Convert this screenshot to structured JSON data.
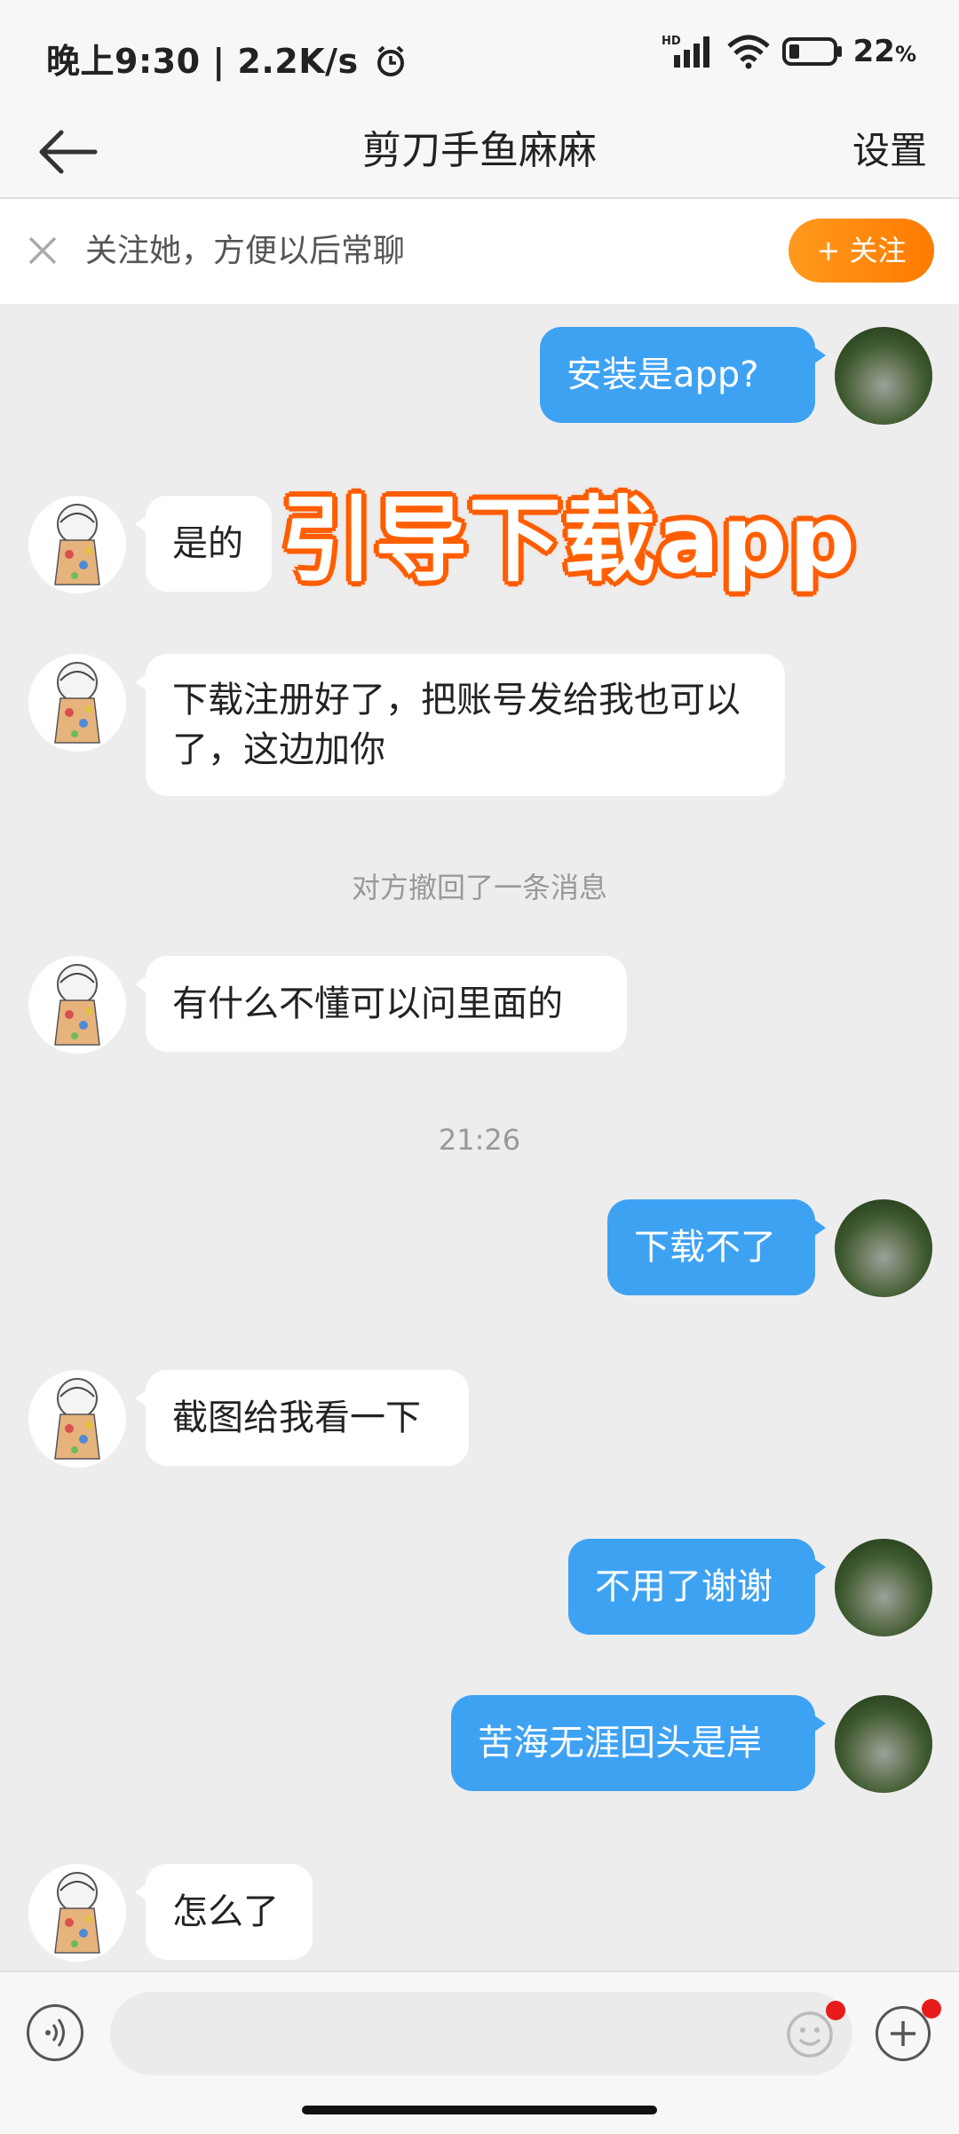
{
  "status_bar": {
    "time": "晚上9:30",
    "speed": "2.2K/s",
    "network": "HD",
    "battery": "22",
    "battery_unit": "%"
  },
  "nav": {
    "title": "剪刀手鱼麻麻",
    "settings_label": "设置"
  },
  "follow_bar": {
    "text": "关注她，方便以后常聊",
    "button_label": "+ 关注"
  },
  "messages": [
    {
      "sender": "me",
      "text": "安装是app?"
    },
    {
      "sender": "other",
      "text": "是的"
    },
    {
      "sender": "other",
      "text": "下载注册好了，把账号发给我也可以了，这边加你"
    },
    {
      "sender": "system",
      "text": "对方撤回了一条消息"
    },
    {
      "sender": "other",
      "text": "有什么不懂可以问里面的"
    },
    {
      "sender": "time",
      "text": "21:26"
    },
    {
      "sender": "me",
      "text": "下载不了"
    },
    {
      "sender": "other",
      "text": "截图给我看一下"
    },
    {
      "sender": "me",
      "text": "不用了谢谢"
    },
    {
      "sender": "me",
      "text": "苦海无涯回头是岸"
    },
    {
      "sender": "other",
      "text": "怎么了"
    }
  ],
  "overlay_caption": "引导下载app",
  "input_bar": {
    "placeholder": ""
  },
  "colors": {
    "my_bubble": "#3ea2f3",
    "other_bubble": "#ffffff",
    "follow_button": "#ff8a00",
    "background": "#ededed"
  }
}
